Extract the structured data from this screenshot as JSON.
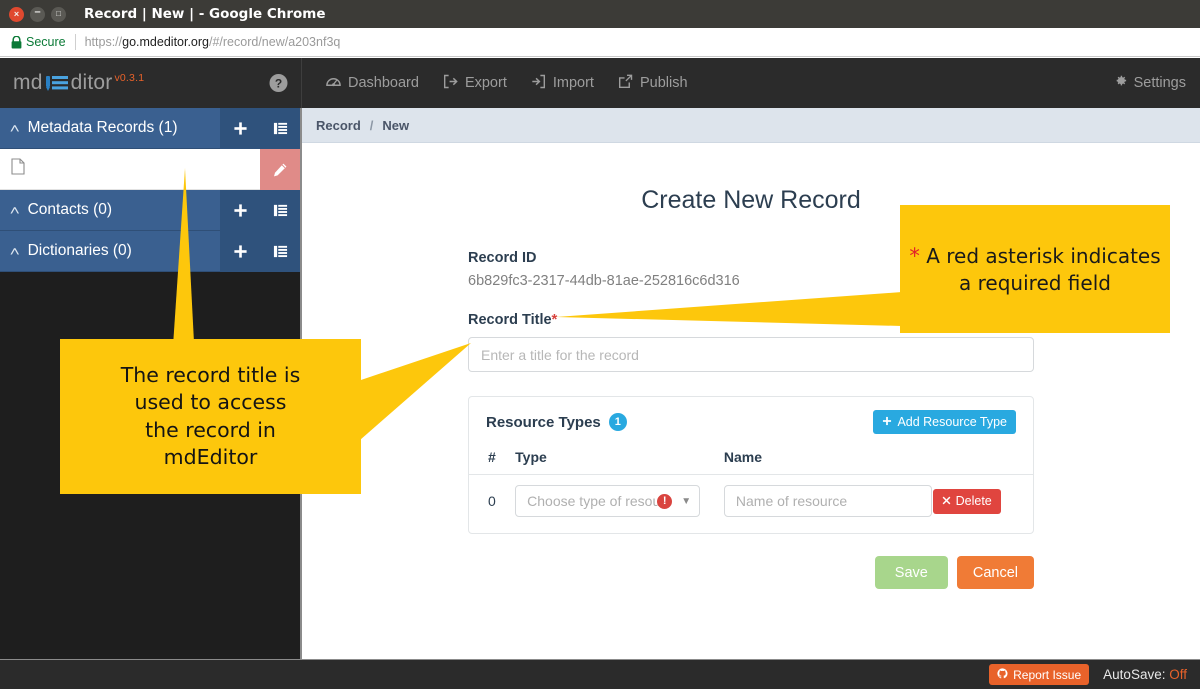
{
  "browser": {
    "window_title": "Record | New | - Google Chrome",
    "security_label": "Secure",
    "url_scheme": "https://",
    "url_host": "go.mdeditor.org",
    "url_path": "/#/record/new/a203nf3q",
    "window_buttons": {
      "close": "×",
      "minimize": "–",
      "maximize": "□"
    }
  },
  "topnav": {
    "brand_left": "md",
    "brand_right": "ditor",
    "version": "v0.3.1",
    "help_icon": "help-circle-icon",
    "items": [
      {
        "label": "Dashboard",
        "icon": "dashboard-icon"
      },
      {
        "label": "Export",
        "icon": "export-icon"
      },
      {
        "label": "Import",
        "icon": "import-icon"
      },
      {
        "label": "Publish",
        "icon": "publish-icon"
      }
    ],
    "settings": {
      "label": "Settings",
      "icon": "gear-icon"
    }
  },
  "sidebar": {
    "groups": [
      {
        "label": "Metadata Records (1)",
        "chevron": "˄",
        "add_icon": "plus-icon",
        "list_icon": "list-icon"
      },
      {
        "label": "Contacts (0)",
        "chevron": "˄",
        "add_icon": "plus-icon",
        "list_icon": "list-icon"
      },
      {
        "label": "Dictionaries (0)",
        "chevron": "˄",
        "add_icon": "plus-icon",
        "list_icon": "list-icon"
      }
    ],
    "record_row": {
      "title": "",
      "doc_icon": "document-icon",
      "edit_icon": "pencil-icon"
    }
  },
  "breadcrumb": {
    "root": "Record",
    "separator": "/",
    "current": "New"
  },
  "main": {
    "page_title": "Create New Record",
    "record_id_label": "Record ID",
    "record_id_value": "6b829fc3-2317-44db-81ae-252816c6d316",
    "record_title_label": "Record Title",
    "required_marker": "*",
    "record_title_placeholder": "Enter a title for the record"
  },
  "resource_panel": {
    "title": "Resource Types",
    "count": "1",
    "add_button": {
      "label": "Add Resource Type",
      "icon": "plus-icon"
    },
    "columns": [
      "#",
      "Type",
      "Name",
      ""
    ],
    "rows": [
      {
        "num": "0",
        "type_placeholder": "Choose type of resource",
        "type_error_icon": "error-exclamation-icon",
        "caret_icon": "chevron-down-icon",
        "name_placeholder": "Name of resource",
        "delete_label": "Delete",
        "delete_icon": "close-x-icon"
      }
    ]
  },
  "actions": {
    "save_label": "Save",
    "cancel_label": "Cancel"
  },
  "footer": {
    "report_label": "Report Issue",
    "report_icon": "github-icon",
    "autosave_label": "AutoSave:",
    "autosave_value": "Off"
  },
  "callouts": {
    "required_field": {
      "star": "*",
      "text": "A red asterisk indicates a required field"
    },
    "record_title": {
      "text": "The record title is\nused to  access\nthe record in\nmdEditor"
    }
  },
  "colors": {
    "callout_yellow": "#fdc70c",
    "sidebar_blue": "#3a6090",
    "accent_blue": "#29a9e0",
    "orange": "#e8622a",
    "danger_red": "#d9443f",
    "save_green": "#a8d68c",
    "cancel_orange": "#f07b36"
  }
}
